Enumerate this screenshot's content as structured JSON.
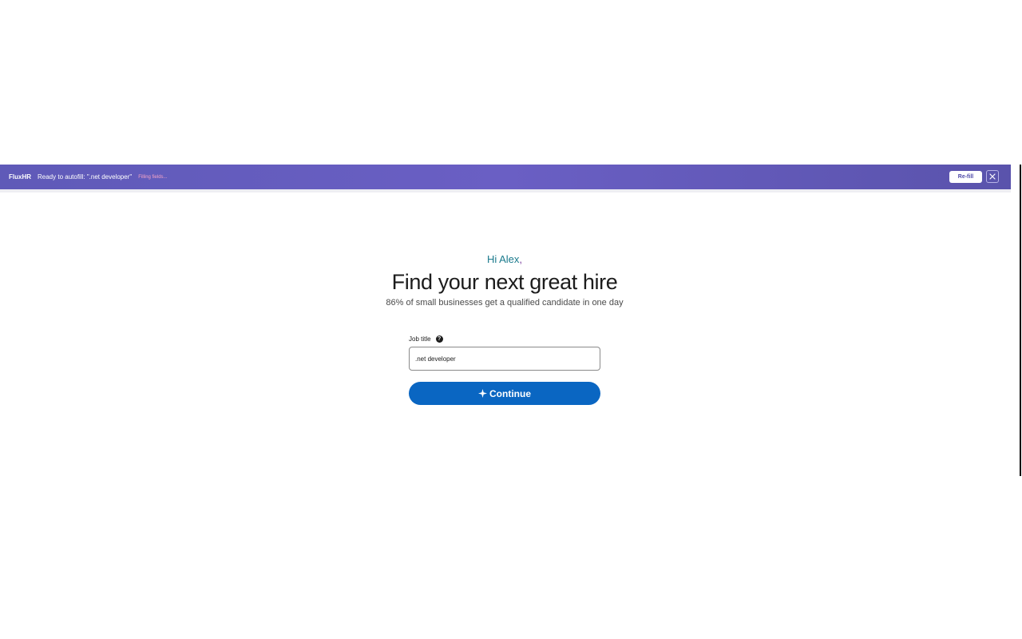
{
  "extension_bar": {
    "brand": "FluxHR",
    "status": "Ready to autofill: \".net developer\"",
    "progress_text": "Filling fields...",
    "refill_label": "Re-fill",
    "close_icon": "close-icon",
    "colors": {
      "background": "#6a5fc4",
      "progress_text": "#f4a4c6"
    }
  },
  "page": {
    "greeting_name": "Hi Alex",
    "greeting_punct": ",",
    "headline": "Find your next great hire",
    "subheadline": "86% of small businesses get a qualified candidate in one day"
  },
  "form": {
    "job_title_label": "Job title",
    "help_icon": "question-circle-icon",
    "job_title_value": ".net developer",
    "continue_label": "Continue",
    "continue_icon": "sparkle-icon",
    "colors": {
      "primary": "#0a66c2",
      "greeting": "#1a7a8c"
    }
  }
}
